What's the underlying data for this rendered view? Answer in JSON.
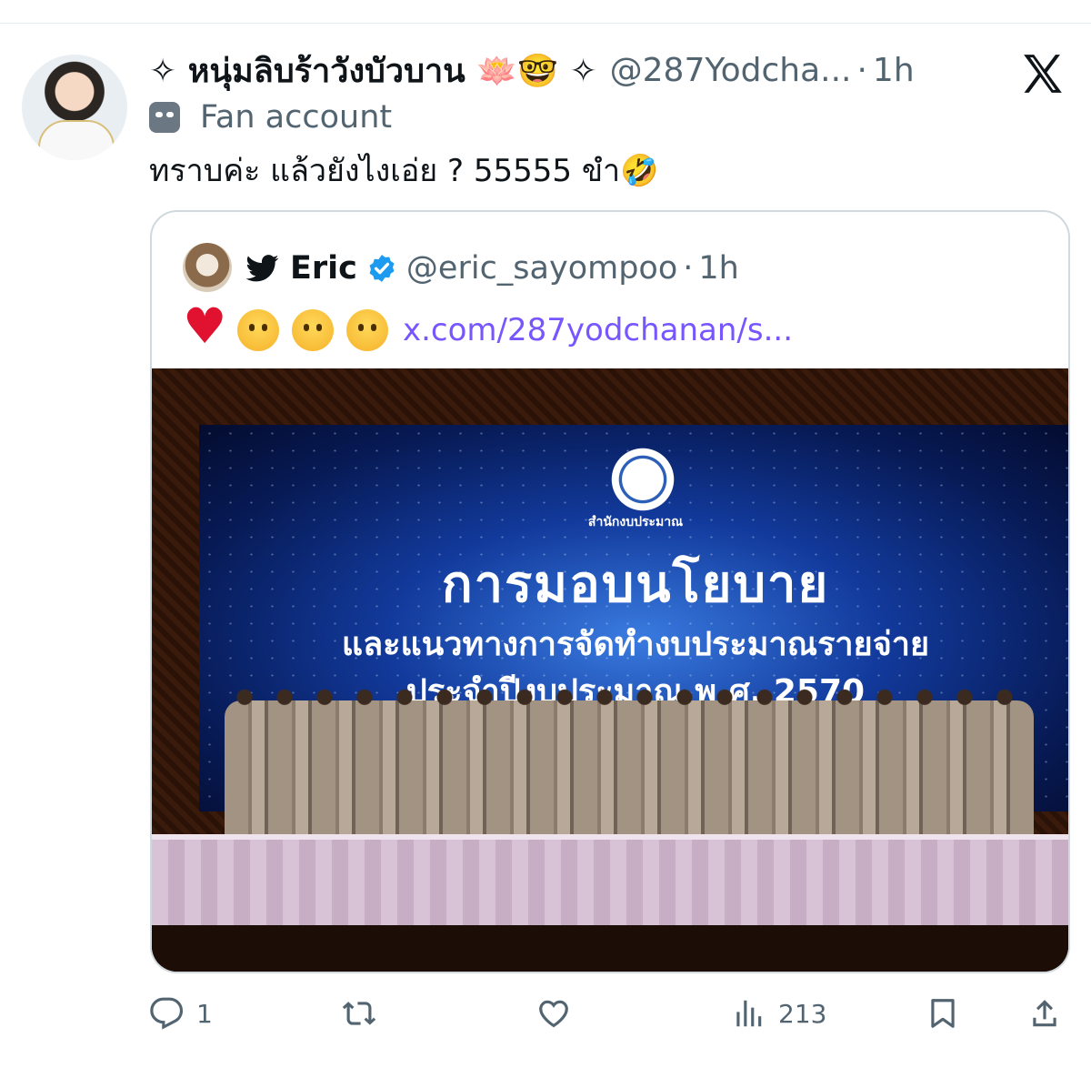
{
  "tweet": {
    "display_name": "✧ หนุ่มลิบร้าวังบัวบาน 🪷🤓 ✧",
    "handle": "@287Yodcha...",
    "dot": "·",
    "time": "1h",
    "account_label": "Fan account",
    "text": "ทราบค่ะ แล้วยังไงเอ่ย ? 55555 ขำ🤣"
  },
  "quote": {
    "display_name": "Eric",
    "handle": "@eric_sayompoo",
    "dot": "·",
    "time": "1h",
    "link": "x.com/287yodchanan/s...",
    "media": {
      "office_label": "สำนักงบประมาณ",
      "line1": "การมอบนโยบาย",
      "line2": "และแนวทางการจัดทำงบประมาณรายจ่าย",
      "line3": "ประจำปีงบประมาณ พ.ศ. 2570"
    }
  },
  "actions": {
    "reply_count": "1",
    "views_count": "213"
  },
  "colors": {
    "link": "#7856ff",
    "verified": "#1d9bf0",
    "muted": "#536471"
  }
}
